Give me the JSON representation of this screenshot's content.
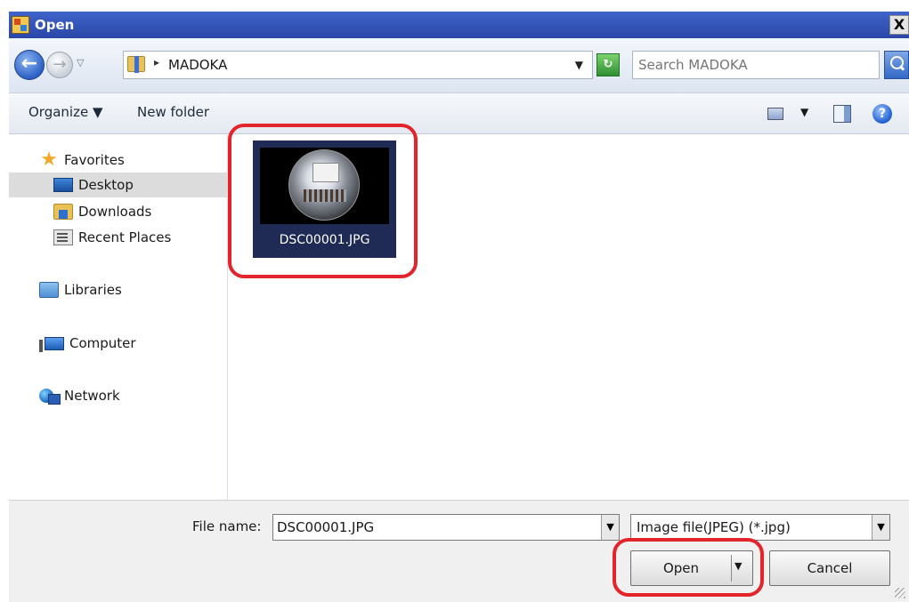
{
  "window": {
    "title": "Open",
    "close_label": "X"
  },
  "navigation": {
    "back_icon": "back-arrow-icon",
    "forward_icon": "forward-arrow-icon",
    "address_path": "MADOKA",
    "search_placeholder": "Search MADOKA"
  },
  "toolbar": {
    "organize_label": "Organize ▼",
    "new_folder_label": "New folder",
    "view_drop": "▼",
    "help_label": "?"
  },
  "sidebar": {
    "items": [
      {
        "label": "Favorites",
        "icon": "star-icon"
      },
      {
        "label": "Desktop",
        "icon": "desktop-icon",
        "selected": true
      },
      {
        "label": "Downloads",
        "icon": "downloads-folder-icon"
      },
      {
        "label": "Recent Places",
        "icon": "recent-places-icon"
      },
      {
        "label": "Libraries",
        "icon": "libraries-icon"
      },
      {
        "label": "Computer",
        "icon": "computer-icon"
      },
      {
        "label": "Network",
        "icon": "network-icon"
      }
    ]
  },
  "files": [
    {
      "name": "DSC00001.JPG",
      "thumbnail": "fisheye-photo",
      "selected": true
    }
  ],
  "footer": {
    "file_name_label": "File name:",
    "file_name_value": "DSC00001.JPG",
    "file_type_value": "Image file(JPEG) (*.jpg)",
    "open_label": "Open",
    "cancel_label": "Cancel"
  },
  "colors": {
    "title_bar": "#2a47a8",
    "selection": "#1f2b55",
    "callout": "#e3242b"
  }
}
